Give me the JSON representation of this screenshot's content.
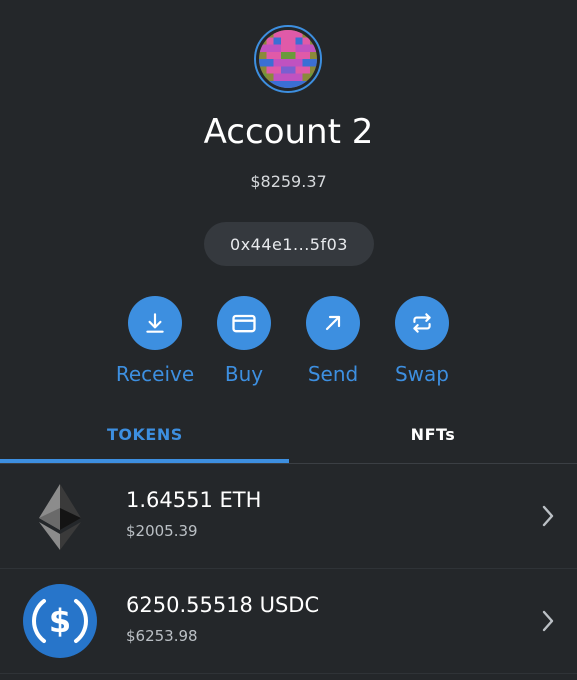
{
  "account": {
    "name": "Account 2",
    "balance": "$8259.37",
    "address": "0x44e1...5f03"
  },
  "actions": [
    {
      "label": "Receive",
      "icon": "download-icon"
    },
    {
      "label": "Buy",
      "icon": "card-icon"
    },
    {
      "label": "Send",
      "icon": "arrow-up-right-icon"
    },
    {
      "label": "Swap",
      "icon": "swap-icon"
    }
  ],
  "tabs": [
    {
      "label": "TOKENS",
      "active": true
    },
    {
      "label": "NFTs",
      "active": false
    }
  ],
  "tokens": [
    {
      "amount": "1.64551 ETH",
      "fiat": "$2005.39",
      "icon": "ethereum-icon"
    },
    {
      "amount": "6250.55518 USDC",
      "fiat": "$6253.98",
      "icon": "usdc-icon"
    }
  ],
  "colors": {
    "background": "#24272a",
    "accent": "#3d8fe0",
    "pill": "#35393e",
    "usdc": "#2775ca"
  }
}
